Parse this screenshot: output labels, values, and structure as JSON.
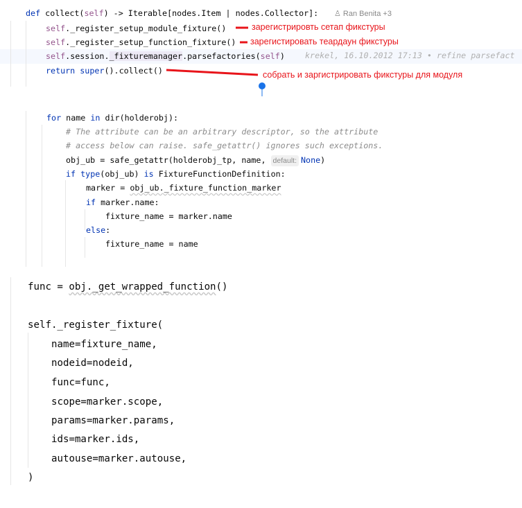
{
  "section1": {
    "author": "Ran Benita +3",
    "blame": "krekel, 16.10.2012 17:13 • refine parsefact",
    "lines": [
      [
        [
          "def ",
          "kw"
        ],
        [
          "collect(",
          ""
        ],
        [
          "self",
          "self"
        ],
        [
          ") -> Iterable[nodes.Item | nodes.Collector]:",
          ""
        ]
      ],
      [
        [
          "self",
          "self"
        ],
        [
          "._register_setup_module_fixture()",
          ""
        ]
      ],
      [
        [
          "self",
          "self"
        ],
        [
          "._register_setup_function_fixture()",
          ""
        ]
      ],
      [
        [
          "self",
          "self"
        ],
        [
          ".session.",
          ""
        ],
        [
          "_fixturemanager",
          "hl"
        ],
        [
          ".parsefactories(",
          ""
        ],
        [
          "self",
          "self"
        ],
        [
          ")",
          ""
        ]
      ],
      [
        [
          "return ",
          "kw"
        ],
        [
          "super",
          "kw"
        ],
        [
          "().collect()",
          ""
        ]
      ]
    ]
  },
  "annotations": {
    "a1": "зарегистрировть сетап фикстуры",
    "a2": "зарегистировать теардаун фикстуры",
    "a3": "собрать и заргистрировать фикстуры для модуля",
    "color": "#e8141a",
    "marker_color": "#1a73e8"
  },
  "section2": {
    "hint": "default:",
    "lines": [
      [
        [
          "for ",
          "kw"
        ],
        [
          "name ",
          ""
        ],
        [
          "in ",
          "kw"
        ],
        [
          "dir(holderobj):",
          ""
        ]
      ],
      [
        [
          "# The attribute can be an arbitrary descriptor, so the attribute",
          "cm"
        ]
      ],
      [
        [
          "# access below can raise. safe_getattr() ignores such exceptions.",
          "cm"
        ]
      ],
      [
        [
          "obj_ub = safe_getattr(holderobj_tp, name, ",
          ""
        ],
        [
          "HINT",
          ""
        ],
        [
          "None",
          "kw"
        ],
        [
          ")",
          ""
        ]
      ],
      [
        [
          "if ",
          "kw"
        ],
        [
          "type",
          "kw"
        ],
        [
          "(obj_ub) ",
          ""
        ],
        [
          "is ",
          "kw"
        ],
        [
          "FixtureFunctionDefinition:",
          ""
        ]
      ],
      [
        [
          "marker = ",
          ""
        ],
        [
          "obj_ub._fixture_function_marker",
          "wavy"
        ]
      ],
      [
        [
          "if ",
          "kw"
        ],
        [
          "marker.name:",
          ""
        ]
      ],
      [
        [
          "fixture_name = marker.name",
          ""
        ]
      ],
      [
        [
          "else",
          "kw"
        ],
        [
          ":",
          ""
        ]
      ],
      [
        [
          "fixture_name = name",
          ""
        ]
      ]
    ]
  },
  "section3": {
    "lines": [
      [
        [
          "func = ",
          ""
        ],
        [
          "obj._get_wrapped_function",
          "wavy"
        ],
        [
          "()",
          ""
        ]
      ],
      [
        [
          "self._register_fixture(",
          ""
        ]
      ],
      [
        [
          "name=fixture_name,",
          ""
        ]
      ],
      [
        [
          "nodeid=nodeid,",
          ""
        ]
      ],
      [
        [
          "func=func,",
          ""
        ]
      ],
      [
        [
          "scope=marker.scope,",
          ""
        ]
      ],
      [
        [
          "params=marker.params,",
          ""
        ]
      ],
      [
        [
          "ids=marker.ids,",
          ""
        ]
      ],
      [
        [
          "autouse=marker.autouse,",
          ""
        ]
      ],
      [
        [
          ")",
          ""
        ]
      ]
    ]
  }
}
